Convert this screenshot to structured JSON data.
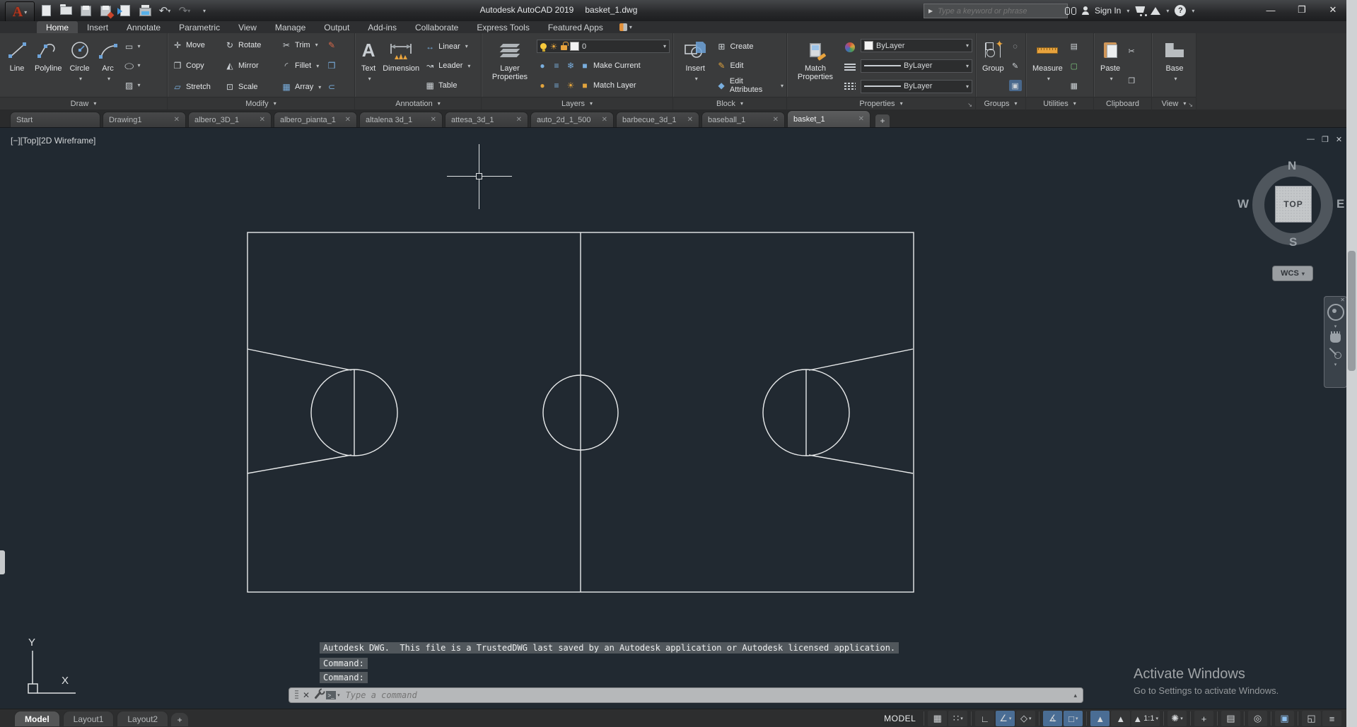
{
  "title_bar": {
    "app_title": "Autodesk AutoCAD 2019",
    "doc_title": "basket_1.dwg",
    "search_placeholder": "Type a keyword or phrase",
    "sign_in": "Sign In",
    "help": "?"
  },
  "glyphs": {
    "caret": "▾",
    "caret_up": "▴",
    "expand": "↘",
    "undo": "↶",
    "redo": "↷",
    "win_min": "—",
    "win_max": "❐",
    "win_close": "✕",
    "doc_min": "—",
    "doc_restore": "❐",
    "doc_close": "✕",
    "move": "✛",
    "rotate": "↻",
    "trim": "✂",
    "copy": "❐",
    "mirror": "◭",
    "fillet": "◜",
    "stretch": "▱",
    "scale": "⊡",
    "array": "▦",
    "erase": "✎",
    "explode": "❒",
    "offset": "⊂",
    "text_big": "A",
    "linear": "↔",
    "leader": "↝",
    "table": "▦",
    "rect": "▭",
    "ellipse": "◯",
    "hatch": "▨",
    "sun": "☀",
    "snowflake": "❄",
    "layers_small": "≡",
    "create": "⊞",
    "edit": "✎",
    "edit_attr": "◆",
    "ungroup": "◌",
    "group_edit": "✎",
    "group_sel": "▣",
    "quick_select": "▤",
    "select_similar": "▢",
    "quick_calc": "▦",
    "cut": "✂",
    "copy_clip": "❐",
    "nav_close": "✕",
    "grid": "▦",
    "snap": "∷",
    "ortho": "∟",
    "polar": "∠",
    "iso": "◇",
    "otrack": "∡",
    "osnap": "□",
    "annot_vis": "▲",
    "autoscale": "▲",
    "annot": "▲",
    "gear": "✺",
    "monitor_plus": "+",
    "qprops": "▤",
    "isolate": "◎",
    "gpu": "▣",
    "clean": "◱",
    "burger": "≡"
  },
  "ribbon_tabs": [
    {
      "label": "Home"
    },
    {
      "label": "Insert"
    },
    {
      "label": "Annotate"
    },
    {
      "label": "Parametric"
    },
    {
      "label": "View"
    },
    {
      "label": "Manage"
    },
    {
      "label": "Output"
    },
    {
      "label": "Add-ins"
    },
    {
      "label": "Collaborate"
    },
    {
      "label": "Express Tools"
    },
    {
      "label": "Featured Apps"
    }
  ],
  "ribbon": {
    "draw": {
      "label": "Draw",
      "buttons": [
        "Line",
        "Polyline",
        "Circle",
        "Arc"
      ]
    },
    "modify": {
      "label": "Modify",
      "buttons": [
        "Move",
        "Rotate",
        "Trim",
        "Copy",
        "Mirror",
        "Fillet",
        "Stretch",
        "Scale",
        "Array"
      ]
    },
    "annotation": {
      "label": "Annotation",
      "big": [
        "Text",
        "Dimension"
      ],
      "small": [
        "Linear",
        "Leader",
        "Table"
      ]
    },
    "layers": {
      "label": "Layers",
      "big": "Layer Properties",
      "current_layer": "0",
      "actions": [
        "Make Current",
        "Match Layer"
      ]
    },
    "block": {
      "label": "Block",
      "big": "Insert",
      "small": [
        "Create",
        "Edit",
        "Edit Attributes"
      ]
    },
    "properties": {
      "label": "Properties",
      "big": "Match Properties",
      "combos": [
        "ByLayer",
        "ByLayer",
        "ByLayer"
      ]
    },
    "groups": {
      "label": "Groups",
      "big": "Group"
    },
    "utilities": {
      "label": "Utilities",
      "big": "Measure"
    },
    "clipboard": {
      "label": "Clipboard",
      "big": "Paste"
    },
    "view": {
      "label": "View",
      "big": "Base"
    }
  },
  "file_tabs": [
    {
      "label": "Start"
    },
    {
      "label": "Drawing1"
    },
    {
      "label": "albero_3D_1"
    },
    {
      "label": "albero_pianta_1"
    },
    {
      "label": "altalena 3d_1"
    },
    {
      "label": "attesa_3d_1"
    },
    {
      "label": "auto_2d_1_500"
    },
    {
      "label": "barbecue_3d_1"
    },
    {
      "label": "baseball_1"
    },
    {
      "label": "basket_1"
    }
  ],
  "viewport": {
    "label": "[−][Top][2D Wireframe]"
  },
  "viewcube": {
    "n": "N",
    "s": "S",
    "e": "E",
    "w": "W",
    "top": "TOP",
    "wcs": "WCS"
  },
  "command": {
    "history_1": "Autodesk DWG.  This file is a TrustedDWG last saved by an Autodesk application or Autodesk licensed application.",
    "history_2": "Command:",
    "history_3": "Command:",
    "placeholder": "Type a command"
  },
  "status_bar": {
    "layout_tabs": [
      "Model",
      "Layout1",
      "Layout2"
    ],
    "model_label": "MODEL",
    "scale": "1:1"
  },
  "watermark": {
    "line1": "Activate Windows",
    "line2": "Go to Settings to activate Windows."
  }
}
